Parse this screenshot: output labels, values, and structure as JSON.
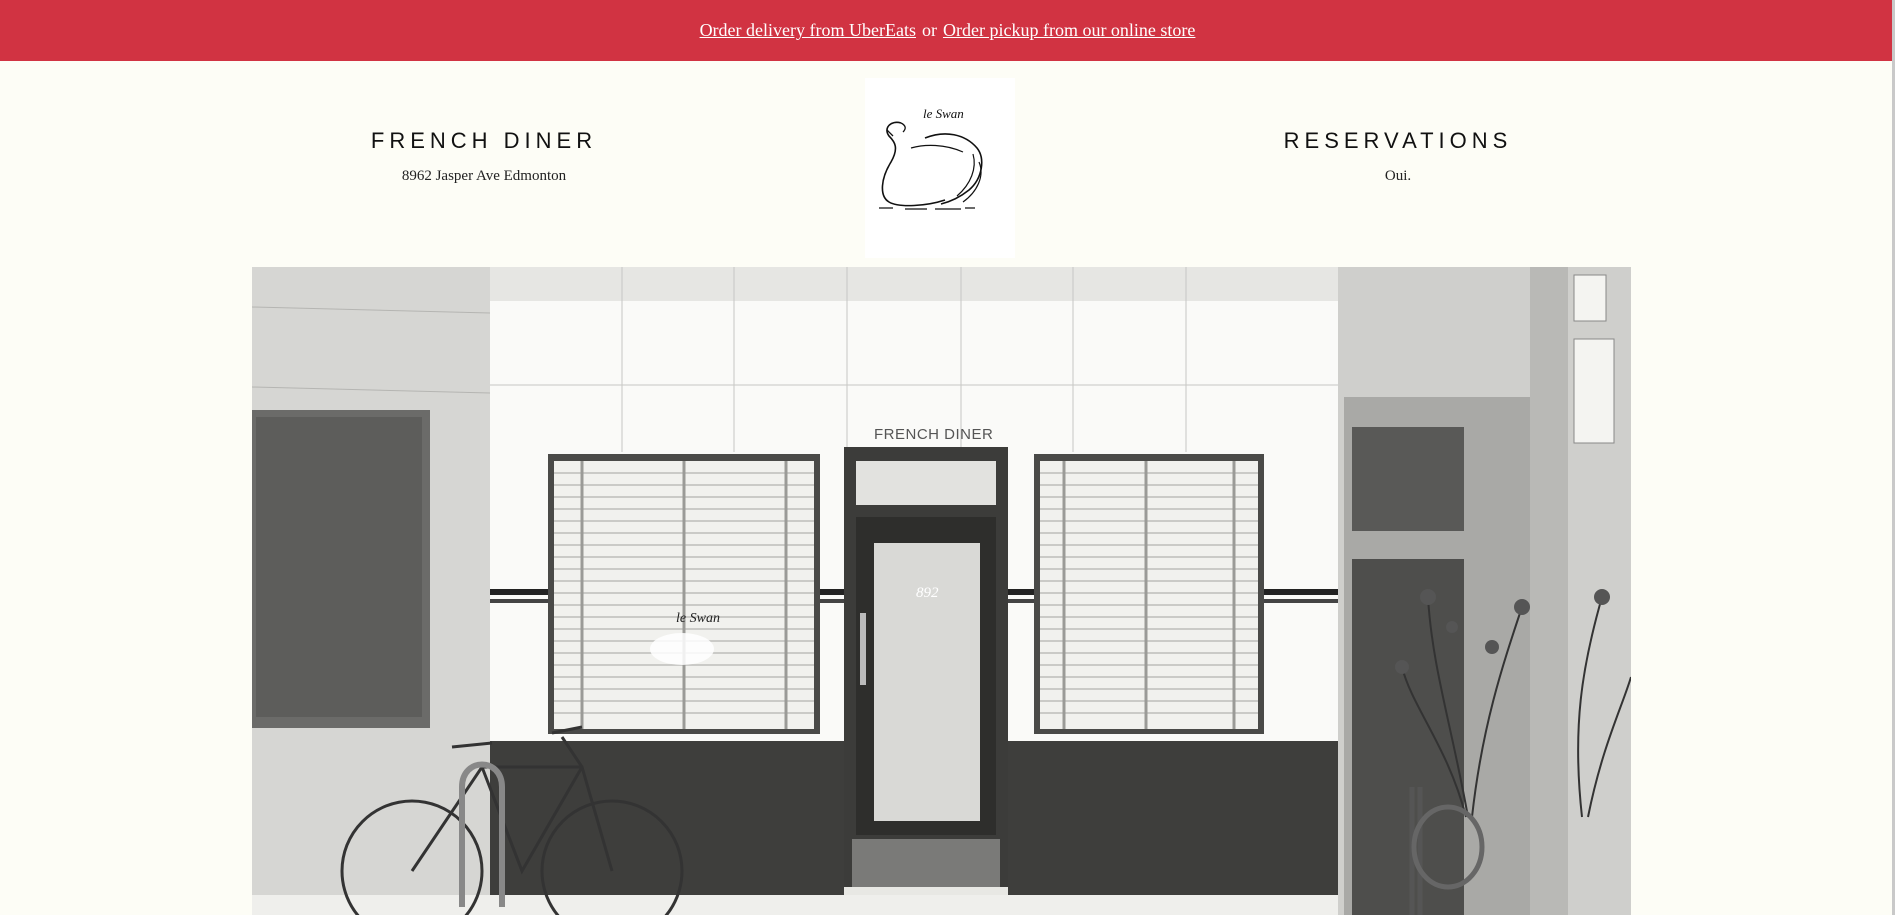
{
  "banner": {
    "delivery_link": "Order delivery from UberEats",
    "separator": "or",
    "pickup_link": "Order pickup from our online store",
    "background_color": "#d13342"
  },
  "header": {
    "left": {
      "title": "FRENCH DINER",
      "subtitle": "8962 Jasper Ave Edmonton"
    },
    "right": {
      "title": "RESERVATIONS",
      "subtitle": "Oui."
    }
  },
  "logo": {
    "icon": "swan-logo-icon",
    "script_text": "le Swan"
  },
  "hero": {
    "icon": "storefront-illustration",
    "sign_text": "FRENCH DINER",
    "door_number": "892",
    "window_logo_text": "le Swan"
  }
}
